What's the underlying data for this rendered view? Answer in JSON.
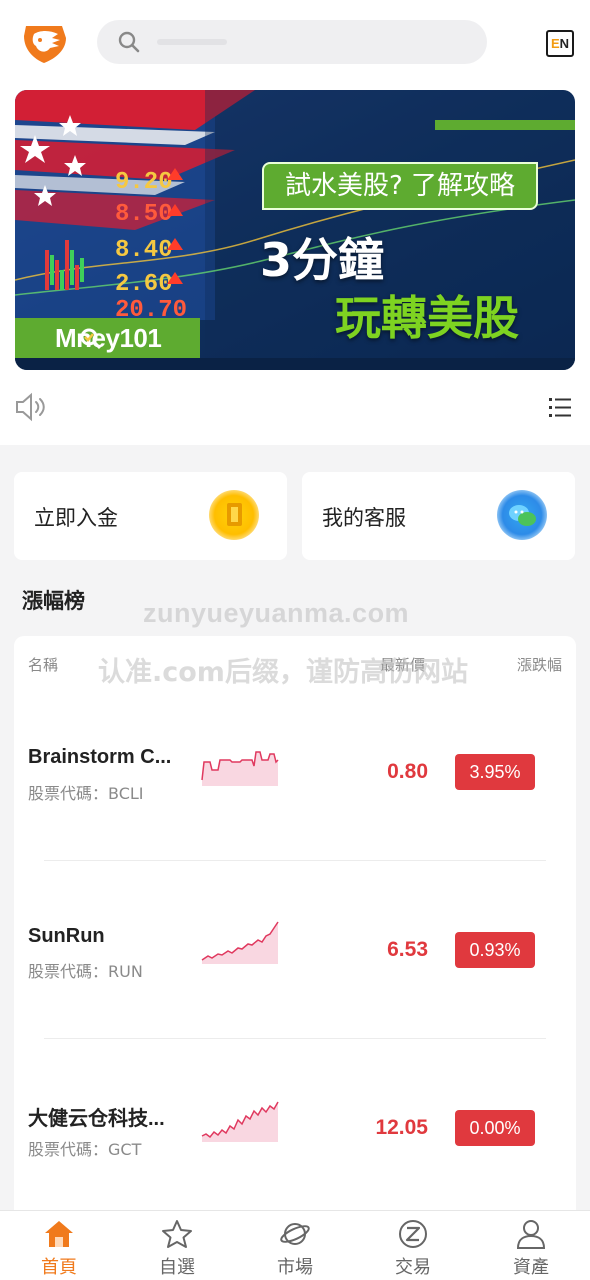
{
  "header": {
    "logo_icon": "lion-logo-icon",
    "search_icon": "search-icon",
    "search_placeholder": "",
    "lang_toggle": {
      "e": "E",
      "n": "N"
    }
  },
  "banner": {
    "promo_text": "試水美股? 了解攻略",
    "headline_1": "3分鐘",
    "headline_2": "玩轉美股",
    "brand": "Mney101",
    "ticker_numbers": [
      "9.20",
      "8.50",
      "8.40",
      "2.60",
      "20.70"
    ]
  },
  "quick_actions": [
    {
      "label": "立即入金",
      "icon": "deposit-coin-icon"
    },
    {
      "label": "我的客服",
      "icon": "customer-service-icon"
    }
  ],
  "gainers": {
    "title": "漲幅榜",
    "headers": {
      "name": "名稱",
      "price": "最新價",
      "change": "漲跌幅"
    },
    "rows": [
      {
        "name": "Brainstorm C...",
        "code": "股票代碼：BCLI",
        "price": "0.80",
        "change": "3.95%"
      },
      {
        "name": "SunRun",
        "code": "股票代碼：RUN",
        "price": "6.53",
        "change": "0.93%"
      },
      {
        "name": "大健云仓科技...",
        "code": "股票代碼：GCT",
        "price": "12.05",
        "change": "0.00%"
      }
    ]
  },
  "watermark": {
    "line1": "zunyueyuanma.com",
    "line2": "认准.com后缀，谨防高仿网站"
  },
  "tabs": [
    {
      "label": "首頁",
      "icon": "home-icon",
      "active": true
    },
    {
      "label": "自選",
      "icon": "star-icon",
      "active": false
    },
    {
      "label": "市場",
      "icon": "planet-icon",
      "active": false
    },
    {
      "label": "交易",
      "icon": "trade-icon",
      "active": false
    },
    {
      "label": "資產",
      "icon": "user-icon",
      "active": false
    }
  ],
  "colors": {
    "accent": "#f07a1c",
    "up_red": "#e0393e",
    "banner_green": "#5eab30"
  }
}
